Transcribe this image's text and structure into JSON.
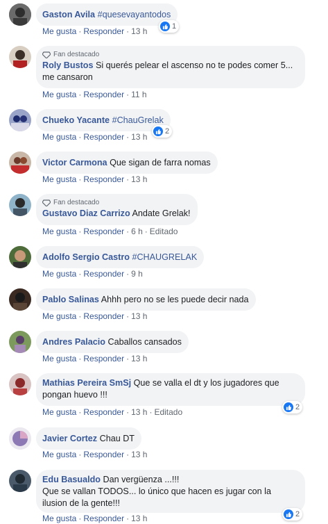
{
  "labels": {
    "like": "Me gusta",
    "reply": "Responder",
    "edited": "Editado"
  },
  "comments": [
    {
      "name": "Gaston Avila",
      "text": "",
      "hashtag": "#quesevayantodos",
      "time": "13 h",
      "reactions": "1",
      "badge": ""
    },
    {
      "name": "Roly Bustos",
      "text": "Si querés pelear el ascenso no te podes comer 5... me cansaron",
      "hashtag": "",
      "time": "11 h",
      "reactions": "",
      "badge": "Fan destacado"
    },
    {
      "name": "Chueko Yacante",
      "text": "",
      "hashtag": "#ChauGrelak",
      "time": "13 h",
      "reactions": "2",
      "badge": ""
    },
    {
      "name": "Victor Carmona",
      "text": "Que sigan de farra nomas",
      "hashtag": "",
      "time": "13 h",
      "reactions": "",
      "badge": ""
    },
    {
      "name": "Gustavo Diaz Carrizo",
      "text": "Andate Grelak!",
      "hashtag": "",
      "time": "6 h",
      "reactions": "",
      "badge": "Fan destacado",
      "edited": true
    },
    {
      "name": "Adolfo Sergio Castro",
      "text": "",
      "hashtag": "#CHAUGRELAK",
      "time": "9 h",
      "reactions": "",
      "badge": ""
    },
    {
      "name": "Pablo Salinas",
      "text": "Ahhh pero no se les puede decir nada",
      "hashtag": "",
      "time": "13 h",
      "reactions": "",
      "badge": ""
    },
    {
      "name": "Andres Palacio",
      "text": "Caballos cansados",
      "hashtag": "",
      "time": "13 h",
      "reactions": "",
      "badge": ""
    },
    {
      "name": "Mathias Pereira SmSj",
      "text": "Que se valla el dt y los jugadores que pongan huevo !!!",
      "hashtag": "",
      "time": "13 h",
      "reactions": "2",
      "badge": "",
      "edited": true
    },
    {
      "name": "Javier Cortez",
      "text": "Chau DT",
      "hashtag": "",
      "time": "13 h",
      "reactions": "",
      "badge": ""
    },
    {
      "name": "Edu Basualdo",
      "text": "Dan vergüenza ...!!!",
      "text2": "Que se vallan TODOS... lo único que hacen es jugar con la ilusion de la gente!!!",
      "hashtag": "",
      "time": "13 h",
      "reactions": "2",
      "badge": ""
    }
  ],
  "colors": {
    "link": "#385898",
    "bubble": "#f2f3f5",
    "meta": "#606770",
    "like_blue": "#1877f2"
  }
}
